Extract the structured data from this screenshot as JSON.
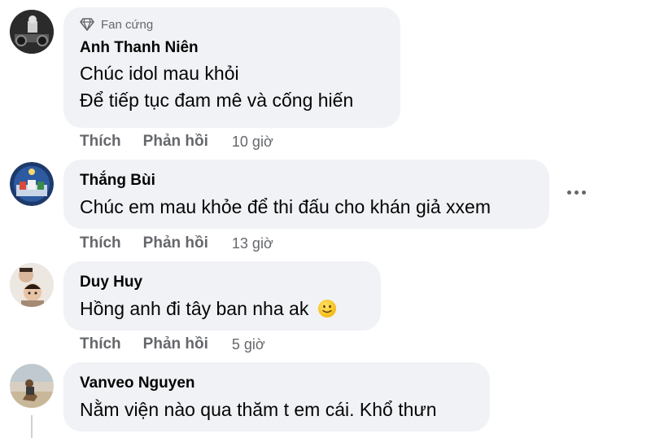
{
  "comments": [
    {
      "badge": "Fan cứng",
      "author": "Anh Thanh Niên",
      "lines": [
        "Chúc idol mau khỏi",
        "Để tiếp tục đam mê và cống hiến"
      ],
      "like": "Thích",
      "reply": "Phản hồi",
      "time": "10 giờ"
    },
    {
      "author": "Thắng Bùi",
      "lines": [
        "Chúc em mau khỏe để thi đấu cho khán giả xxem"
      ],
      "like": "Thích",
      "reply": "Phản hồi",
      "time": "13 giờ"
    },
    {
      "author": "Duy Huy",
      "lines": [
        "Hồng anh đi tây ban nha ak"
      ],
      "emoji": "slightly-smiling-face",
      "like": "Thích",
      "reply": "Phản hồi",
      "time": "5 giờ"
    },
    {
      "author": "Vanveo Nguyen",
      "lines": [
        "Nằm viện nào qua thăm t em cái. Khổ thưn"
      ]
    }
  ],
  "colors": {
    "bubble": "#f0f2f5",
    "muted": "#65676b",
    "text": "#050505"
  }
}
